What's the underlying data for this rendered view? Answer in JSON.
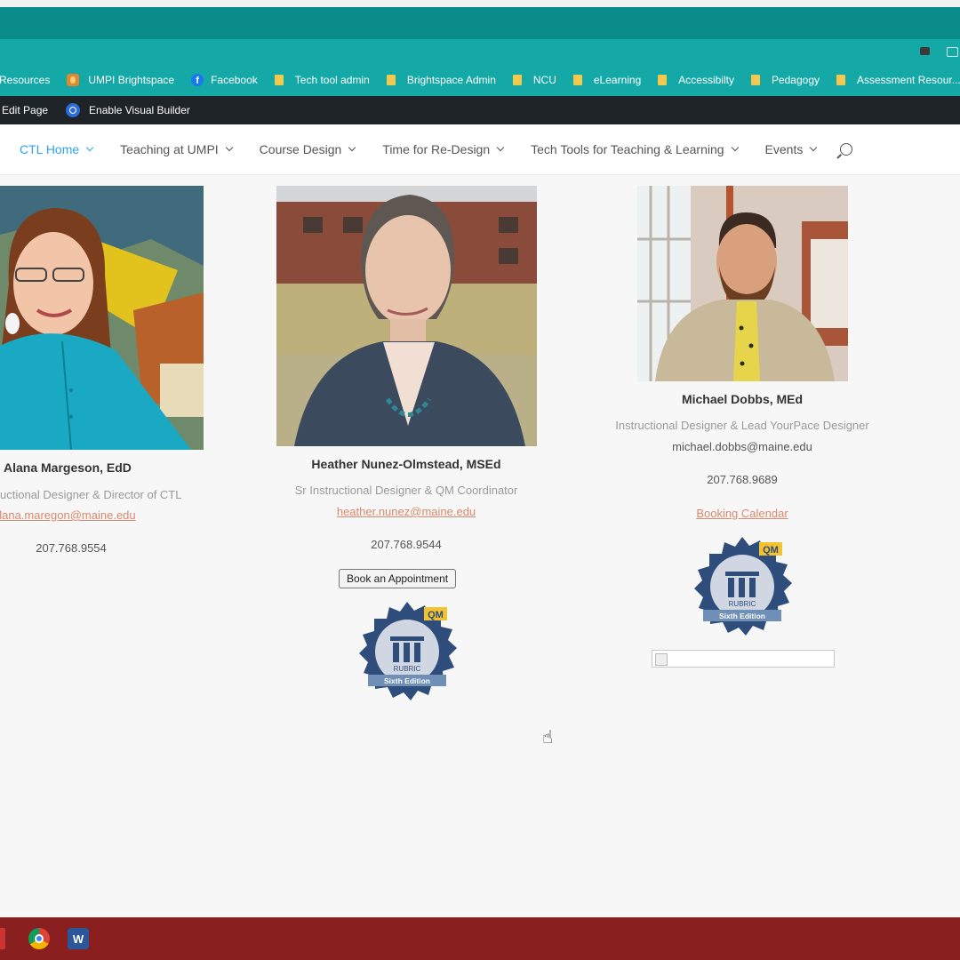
{
  "bookmarks": [
    {
      "label": "Resources",
      "icon": "none"
    },
    {
      "label": "UMPI Brightspace",
      "icon": "brightspace-icon"
    },
    {
      "label": "Facebook",
      "icon": "facebook-icon"
    },
    {
      "label": "Tech tool admin",
      "icon": "folder-icon"
    },
    {
      "label": "Brightspace Admin",
      "icon": "folder-icon"
    },
    {
      "label": "NCU",
      "icon": "folder-icon"
    },
    {
      "label": "eLearning",
      "icon": "folder-icon"
    },
    {
      "label": "Accessibilty",
      "icon": "folder-icon"
    },
    {
      "label": "Pedagogy",
      "icon": "folder-icon"
    },
    {
      "label": "Assessment Resour...",
      "icon": "folder-icon"
    }
  ],
  "admin_bar": {
    "edit_page": "Edit Page",
    "visual_builder": "Enable Visual Builder"
  },
  "nav": {
    "items": [
      {
        "label": "CTL Home",
        "active": true
      },
      {
        "label": "Teaching at UMPI",
        "active": false
      },
      {
        "label": "Course Design",
        "active": false
      },
      {
        "label": "Time for Re-Design",
        "active": false
      },
      {
        "label": "Tech Tools for Teaching & Learning",
        "active": false
      },
      {
        "label": "Events",
        "active": false
      }
    ]
  },
  "staff": [
    {
      "name": "Alana Margeson, EdD",
      "title": "uctional Designer & Director of CTL",
      "email": "alana.maregon@maine.edu",
      "phone": "207.768.9554"
    },
    {
      "name": "Heather Nunez-Olmstead, MSEd",
      "title": "Sr Instructional Designer & QM Coordinator",
      "email": "heather.nunez@maine.edu",
      "phone": "207.768.9544",
      "button": "Book an Appointment"
    },
    {
      "name": "Michael Dobbs, MEd",
      "title": "Instructional Designer & Lead YourPace Designer",
      "email": "michael.dobbs@maine.edu",
      "phone": "207.768.9689",
      "booking_link": "Booking Calendar"
    }
  ],
  "badge": {
    "top": "QM",
    "middle": "RUBRIC",
    "bottom": "Sixth Edition"
  },
  "colors": {
    "browser_teal": "#14a8a6",
    "admin_bar": "#1d2327",
    "nav_active": "#2ea3f2",
    "link": "#d9886e",
    "taskbar": "#8a1f1f"
  }
}
